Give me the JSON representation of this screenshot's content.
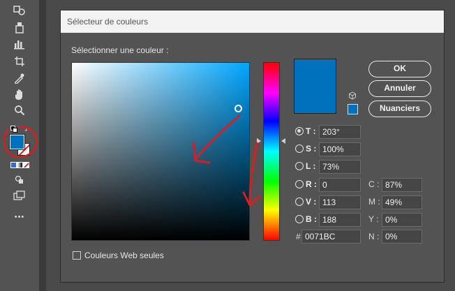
{
  "dialog": {
    "title": "Sélecteur de couleurs",
    "select_label": "Sélectionner une couleur :",
    "current_color": "#0071BC",
    "buttons": {
      "ok": "OK",
      "cancel": "Annuler",
      "swatches": "Nuanciers"
    },
    "websafe_label": "Couleurs Web seules",
    "websafe_checked": false,
    "hsb": [
      {
        "key": "T",
        "label": "T :",
        "value": "203°",
        "selected": true
      },
      {
        "key": "S",
        "label": "S :",
        "value": "100%",
        "selected": false
      },
      {
        "key": "L",
        "label": "L :",
        "value": "73%",
        "selected": false
      }
    ],
    "rgb": [
      {
        "key": "R",
        "label": "R :",
        "value": "0",
        "selected": false
      },
      {
        "key": "V",
        "label": "V :",
        "value": "113",
        "selected": false
      },
      {
        "key": "B",
        "label": "B :",
        "value": "188",
        "selected": false
      }
    ],
    "hex_prefix": "#",
    "hex": "0071BC",
    "cmyk": [
      {
        "label": "C :",
        "value": "87%"
      },
      {
        "label": "M :",
        "value": "49%"
      },
      {
        "label": "Y :",
        "value": "0%"
      },
      {
        "label": "N :",
        "value": "0%"
      }
    ]
  },
  "toolbar": {
    "tools": [
      "fill-stroke-swap-icon",
      "paint-bucket-icon",
      "chart-icon",
      "crop-icon",
      "eyedropper-icon",
      "hand-icon",
      "zoom-icon"
    ],
    "more_label": "•••"
  },
  "colors": {
    "annotation": "#d81e1e",
    "swatch_fill": "#0071BC"
  }
}
